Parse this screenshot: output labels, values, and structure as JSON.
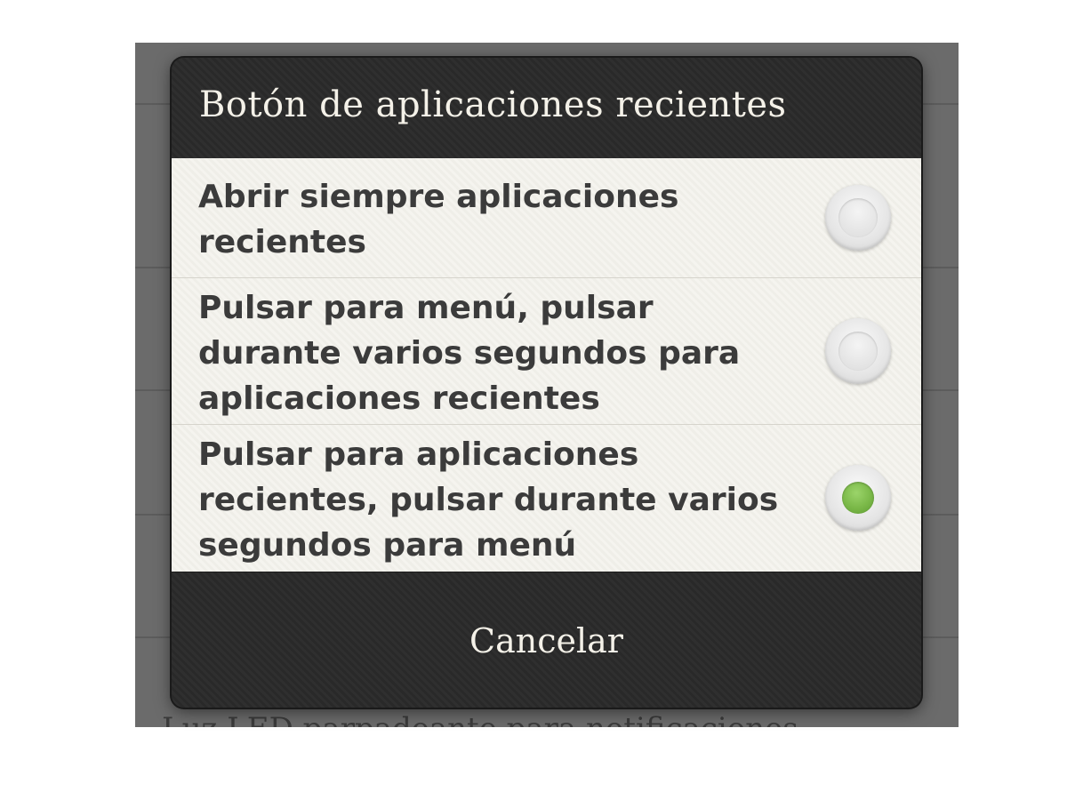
{
  "dialog": {
    "title": "Botón de aplicaciones recientes",
    "options": [
      {
        "label": "Abrir siempre aplicaciones recientes",
        "selected": false
      },
      {
        "label": "Pulsar para menú, pulsar durante varios segundos para aplicaciones recientes",
        "selected": false
      },
      {
        "label": "Pulsar para aplicaciones recientes, pulsar durante varios segundos para menú",
        "selected": true
      }
    ],
    "cancel_label": "Cancelar"
  },
  "background": {
    "footer_text": "Luz LED parpadeante para notificaciones"
  },
  "colors": {
    "selected_radio": "#7ab848",
    "dialog_dark": "#2c2c2c",
    "option_bg": "#f3f2ed",
    "title_text": "#f4f1e8",
    "option_text": "#3b3b3b"
  }
}
